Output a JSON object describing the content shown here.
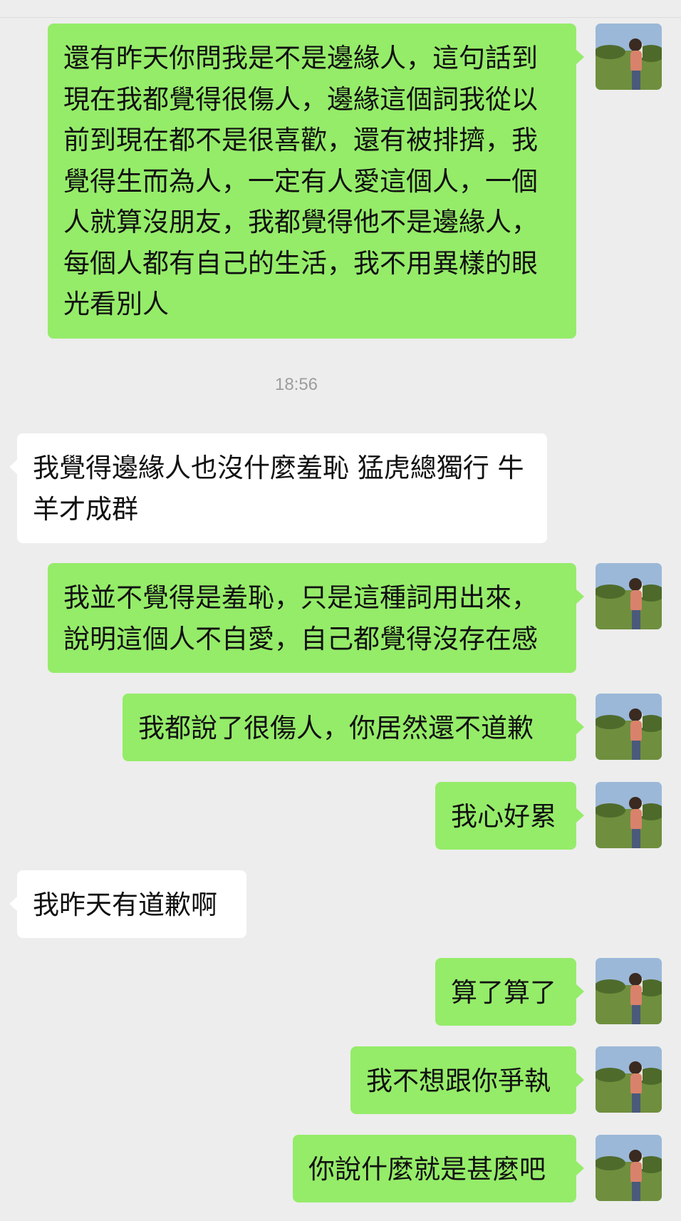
{
  "chat": {
    "timestamp": "18:56",
    "messages": [
      {
        "side": "sent",
        "text": "還有昨天你問我是不是邊緣人，這句話到現在我都覺得很傷人，邊緣這個詞我從以前到現在都不是很喜歡，還有被排擠，我覺得生而為人，一定有人愛這個人，一個人就算沒朋友，我都覺得他不是邊緣人，每個人都有自己的生活，我不用異樣的眼光看別人"
      },
      {
        "side": "recv",
        "text": "我覺得邊緣人也沒什麼羞恥 猛虎總獨行 牛羊才成群"
      },
      {
        "side": "sent",
        "text": "我並不覺得是羞恥，只是這種詞用出來，說明這個人不自愛，自己都覺得沒存在感"
      },
      {
        "side": "sent",
        "text": "我都說了很傷人，你居然還不道歉"
      },
      {
        "side": "sent",
        "text": "我心好累"
      },
      {
        "side": "recv",
        "text": "我昨天有道歉啊"
      },
      {
        "side": "sent",
        "text": "算了算了"
      },
      {
        "side": "sent",
        "text": "我不想跟你爭執"
      },
      {
        "side": "sent",
        "text": "你說什麼就是甚麼吧"
      }
    ]
  },
  "colors": {
    "background": "#ededed",
    "sent_bubble": "#95ec69",
    "received_bubble": "#ffffff",
    "timestamp_text": "#9d9d9d"
  },
  "icons": {
    "avatar": "user-photo-avatar-icon"
  }
}
